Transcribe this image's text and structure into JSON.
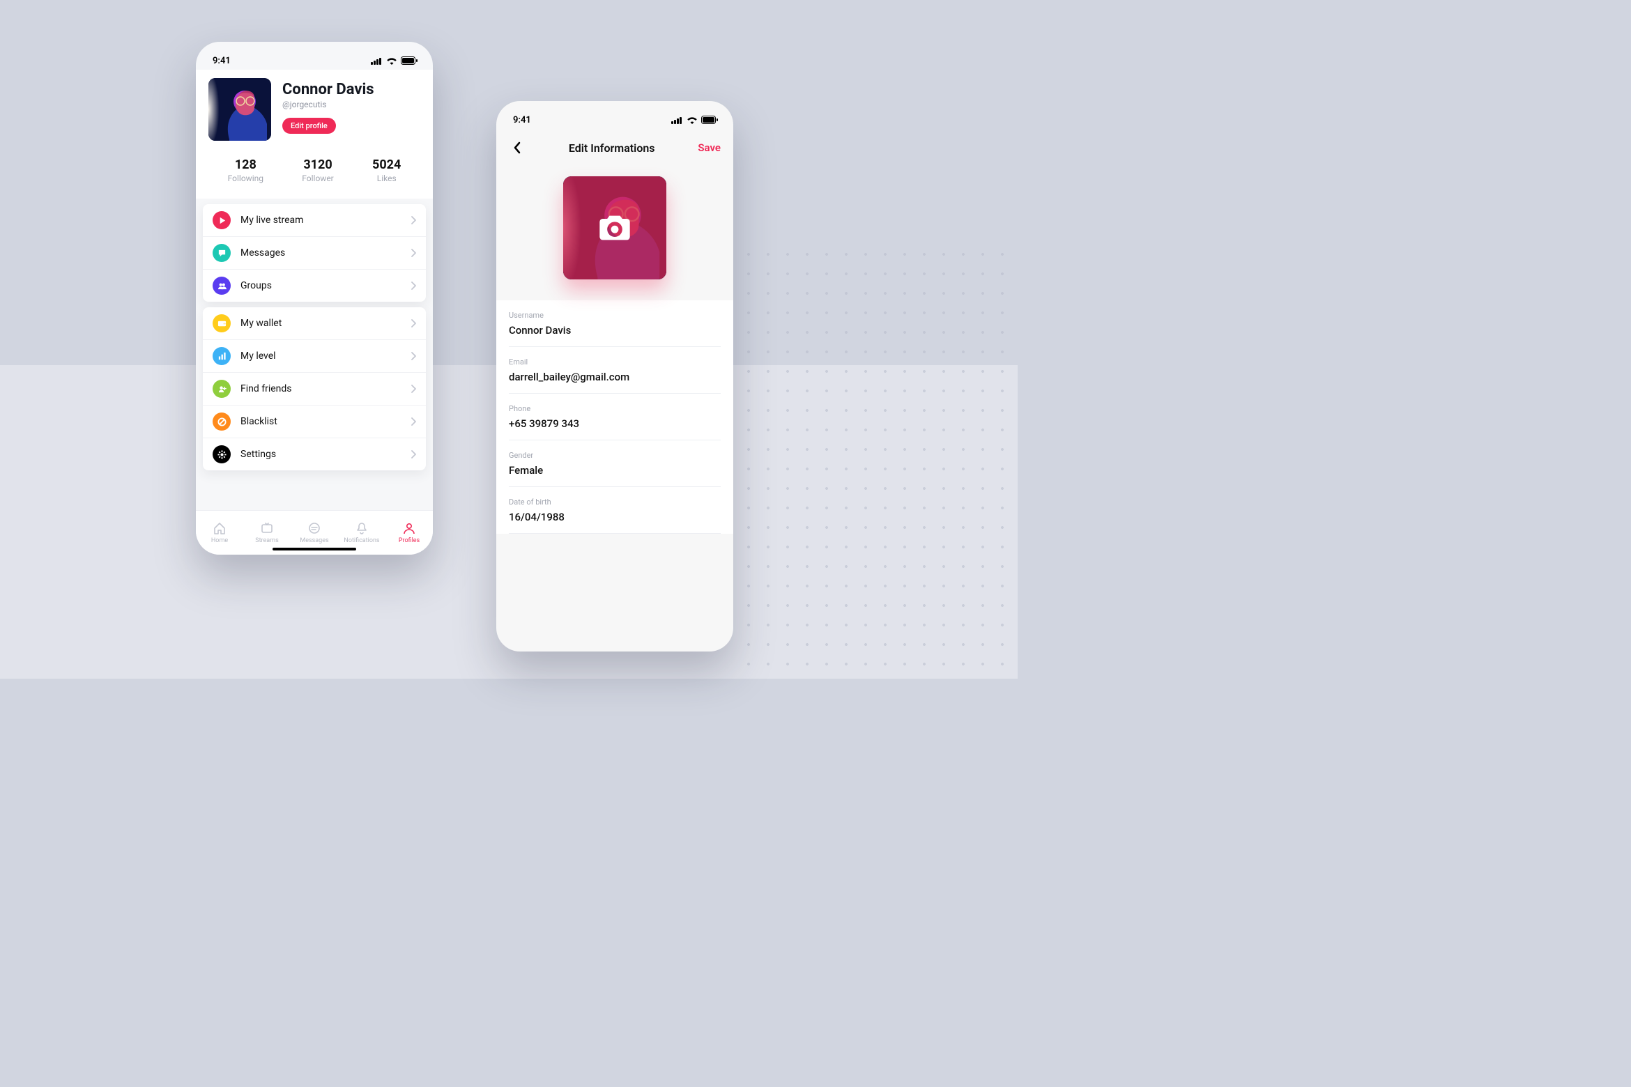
{
  "status": {
    "time": "9:41"
  },
  "profile": {
    "name": "Connor Davis",
    "at": "@jorgecutis",
    "edit_label": "Edit profile",
    "stats": {
      "following": {
        "value": "128",
        "label": "Following"
      },
      "follower": {
        "value": "3120",
        "label": "Follower"
      },
      "likes": {
        "value": "5024",
        "label": "Likes"
      }
    }
  },
  "menu": {
    "group1": [
      {
        "label": "My live stream",
        "color": "#ef2a57",
        "icon": "play"
      },
      {
        "label": "Messages",
        "color": "#1cc8b3",
        "icon": "chat"
      },
      {
        "label": "Groups",
        "color": "#5a3cf0",
        "icon": "people"
      }
    ],
    "group2": [
      {
        "label": "My wallet",
        "color": "#ffcc1b",
        "icon": "wallet"
      },
      {
        "label": "My level",
        "color": "#3db2f6",
        "icon": "bars"
      },
      {
        "label": "Find friends",
        "color": "#8fce3d",
        "icon": "addfriend"
      },
      {
        "label": "Blacklist",
        "color": "#ff8a1b",
        "icon": "block"
      },
      {
        "label": "Settings",
        "color": "#000000",
        "icon": "gear"
      }
    ]
  },
  "tabs": [
    {
      "label": "Home",
      "icon": "home"
    },
    {
      "label": "Streams",
      "icon": "streams"
    },
    {
      "label": "Messages",
      "icon": "messages"
    },
    {
      "label": "Notifications",
      "icon": "bell"
    },
    {
      "label": "Profiles",
      "icon": "profile"
    }
  ],
  "active_tab": 4,
  "edit": {
    "title": "Edit Informations",
    "save": "Save",
    "fields": {
      "username": {
        "label": "Username",
        "value": "Connor Davis"
      },
      "email": {
        "label": "Email",
        "value": "darrell_bailey@gmail.com"
      },
      "phone": {
        "label": "Phone",
        "value": "+65 39879 343"
      },
      "gender": {
        "label": "Gender",
        "value": "Female"
      },
      "dob": {
        "label": "Date of birth",
        "value": "16/04/1988"
      }
    }
  }
}
